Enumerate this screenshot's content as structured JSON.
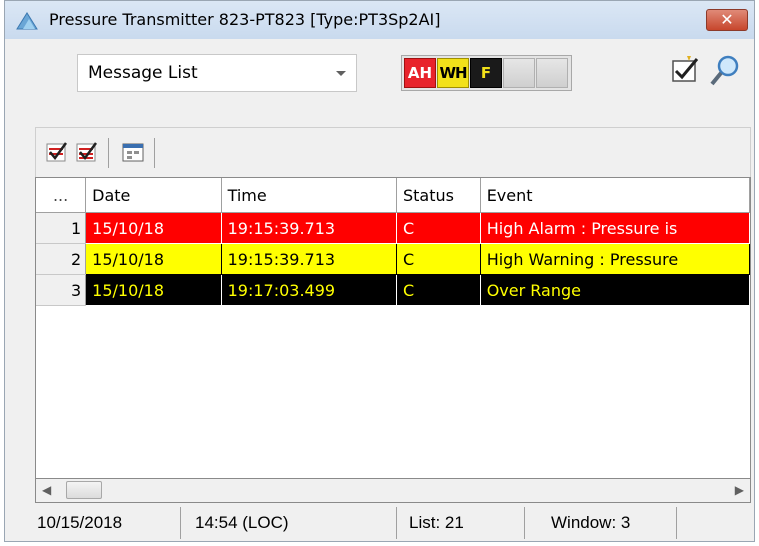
{
  "window": {
    "title": "Pressure Transmitter 823-PT823  [Type:PT3Sp2AI]",
    "close_label": "✕"
  },
  "toolbar": {
    "view_selector": {
      "value": "Message List"
    },
    "filters": [
      {
        "label": "AH",
        "color": "#e8232b"
      },
      {
        "label": "WH",
        "color": "#f2e11a"
      },
      {
        "label": "F",
        "color": "#1a1a1a"
      },
      {
        "label": "",
        "color": "#d8d8d8"
      },
      {
        "label": "",
        "color": "#d8d8d8"
      }
    ],
    "icons": [
      "filter-check-icon",
      "search-icon"
    ]
  },
  "list_toolbar": {
    "icons": [
      "acknowledge-icon",
      "acknowledge-all-icon",
      "calendar-icon"
    ]
  },
  "table": {
    "columns": [
      "...",
      "Date",
      "Time",
      "Status",
      "Event"
    ],
    "rows": [
      {
        "num": "1",
        "date": "15/10/18",
        "time": "19:15:39.713",
        "status": "C",
        "event": "High Alarm : Pressure is",
        "type": "alarm"
      },
      {
        "num": "2",
        "date": "15/10/18",
        "time": "19:15:39.713",
        "status": "C",
        "event": "High Warning : Pressure",
        "type": "warning"
      },
      {
        "num": "3",
        "date": "15/10/18",
        "time": "19:17:03.499",
        "status": "C",
        "event": "Over Range",
        "type": "overrange"
      }
    ],
    "row_colors": {
      "alarm": "#ff0000",
      "warning": "#ffff00",
      "overrange": "#000000"
    }
  },
  "statusbar": {
    "date": "10/15/2018",
    "time": "14:54 (LOC)",
    "list": "List: 21",
    "window": "Window: 3"
  }
}
